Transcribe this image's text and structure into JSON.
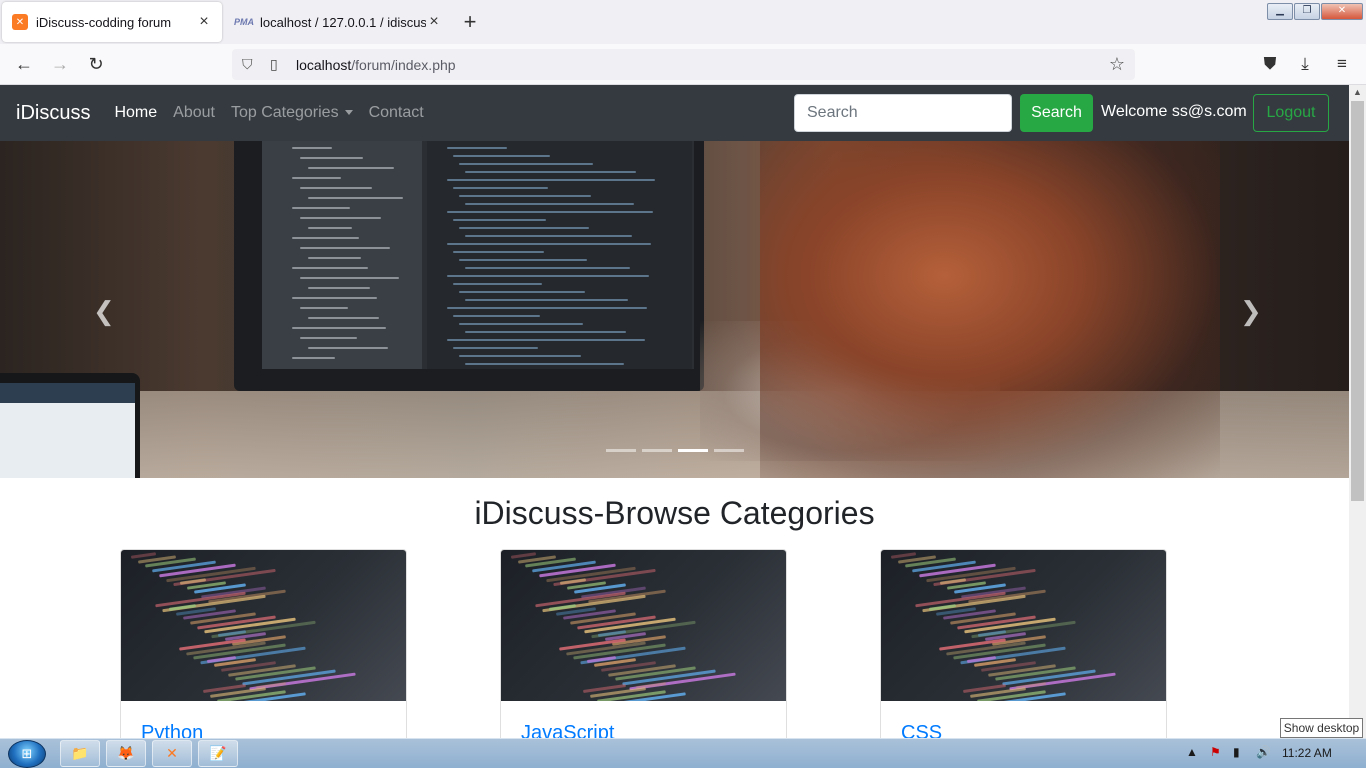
{
  "browser": {
    "tabs": [
      {
        "title": "iDiscuss-codding forum",
        "active": true
      },
      {
        "title": "localhost / 127.0.0.1 / idiscuss /",
        "active": false
      }
    ],
    "url_host": "localhost",
    "url_path": "/forum/index.php"
  },
  "nav": {
    "brand": "iDiscuss",
    "links": [
      "Home",
      "About",
      "Top Categories",
      "Contact"
    ],
    "search_placeholder": "Search",
    "search_button": "Search",
    "welcome": "Welcome ss@s.com",
    "logout": "Logout"
  },
  "carousel": {
    "slide_count": 4,
    "active_slide": 3
  },
  "categories": {
    "heading": "iDiscuss-Browse Categories",
    "items": [
      "Python",
      "JavaScript",
      "CSS"
    ]
  },
  "taskbar": {
    "clock": "11:22 AM",
    "show_desktop": "Show desktop"
  },
  "colors": {
    "navbar": "#343a40",
    "success": "#28a745",
    "link": "#007bff"
  }
}
